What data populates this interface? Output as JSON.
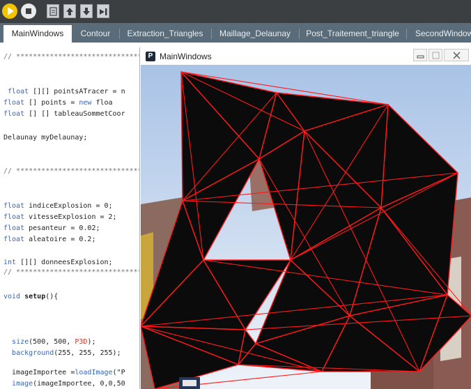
{
  "toolbar": {
    "buttons": [
      "run-icon",
      "stop-icon",
      "new-sketch-icon",
      "open-icon",
      "save-icon",
      "export-icon"
    ],
    "colors": {
      "bg": "#3b3f42",
      "run": "#f3c200"
    }
  },
  "tabs": [
    {
      "label": "MainWindows",
      "active": true
    },
    {
      "label": "Contour",
      "active": false
    },
    {
      "label": "Extraction_Triangles",
      "active": false
    },
    {
      "label": "Maillage_Delaunay",
      "active": false
    },
    {
      "label": "Post_Traitement_triangle",
      "active": false
    },
    {
      "label": "SecondWindow",
      "active": false
    }
  ],
  "code_lines": [
    "// ******************************",
    "",
    "",
    " float [][] pointsATracer = n",
    "float [] points = new floa",
    "float [] [] tableauSommetCoor",
    "",
    "Delaunay myDelaunay;",
    "",
    "",
    "// ******************************",
    "",
    "",
    "",
    "float indiceExplosion = 0;",
    "float vitesseExplosion = 2;",
    "float pesanteur = 0.02;",
    "float aleatoire = 0.2;",
    "",
    "int [][] donneesExplosion;",
    "// ******************************",
    "",
    "void setup(){",
    "",
    "",
    "",
    "",
    "  size(500, 500, P3D);",
    "  background(255, 255, 255);",
    "",
    "  imageImportee =loadImage(\"P",
    "  image(imageImportee, 0,0,50"
  ],
  "sketch_window": {
    "title": "MainWindows",
    "logo": "P",
    "controls": [
      "minimize-icon",
      "maximize-icon",
      "close-icon"
    ]
  },
  "colors": {
    "mesh": "#ff1a1a",
    "sky": "#c9d9ee",
    "shard": "#0b0b0b"
  }
}
